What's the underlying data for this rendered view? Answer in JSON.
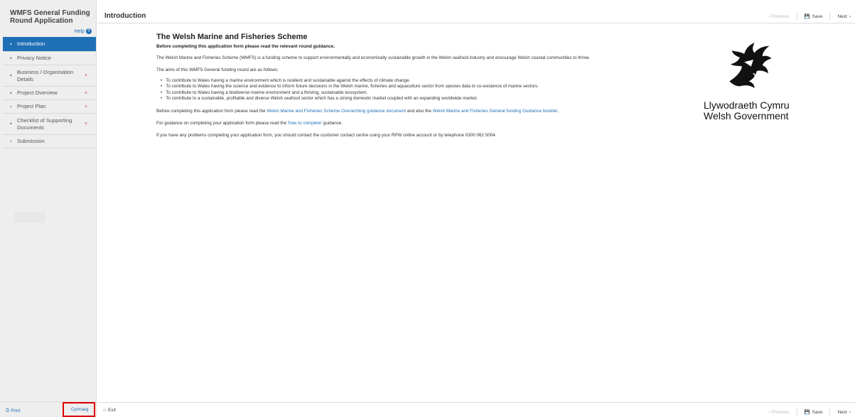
{
  "app": {
    "title": "WMFS General Funding Round Application"
  },
  "sidebar": {
    "help_label": "Help",
    "items": [
      {
        "label": "Introduction",
        "icon": "file-icon",
        "active": true,
        "error": false
      },
      {
        "label": "Privacy Notice",
        "icon": "file-icon",
        "active": false,
        "error": false
      },
      {
        "label": "Business / Organisation Details",
        "icon": "file-icon",
        "active": false,
        "error": true
      },
      {
        "label": "Project Overview",
        "icon": "file-icon",
        "active": false,
        "error": true
      },
      {
        "label": "Project Plan",
        "icon": "chevron-right-icon",
        "active": false,
        "error": true
      },
      {
        "label": "Checklist of Supporting Documents",
        "icon": "file-icon",
        "active": false,
        "error": true
      },
      {
        "label": "Submission",
        "icon": "chevron-right-icon",
        "active": false,
        "error": false
      }
    ],
    "error_mark": "×",
    "print_label": "Print",
    "cymraeg_label": "Cymraeg"
  },
  "header": {
    "page_title": "Introduction",
    "prev_label": "Previous",
    "save_label": "Save",
    "next_label": "Next"
  },
  "content": {
    "heading": "The Welsh Marine and Fisheries Scheme",
    "lead": "Before completing this application form please read the relevant round guidance.",
    "intro": "The Welsh Marine and Fisheries Scheme (WMFS) is a funding scheme to support environmentally and economically sustainable growth in the Welsh seafood industry and encourage Welsh coastal communities to thrive.",
    "aims_intro": "The aims of this WMFS General funding round are as follows:",
    "aims": [
      "To contribute to Wales having a marine environment which is resilient and sustainable against the effects of climate change.",
      "To contribute to Wales having the science and evidence to inform future decisions in the Welsh marine, fisheries and aquaculture sector from species data to co-existence of marine sectors.",
      "To contribute to Wales having a biodiverse marine environment and a thriving, sustainable ecosystem.",
      "To contribute to a sustainable, profitable and diverse Welsh seafood sector which has a strong domestic market coupled with an expanding worldwide market."
    ],
    "guidance_pre": "Before completing this application form please read the ",
    "guidance_link1": "Welsh Marine and Fisheries Scheme Overarching guidance document",
    "guidance_mid": " and also the ",
    "guidance_link2": "Welsh Marine and Fisheries General funding Guidance booklet",
    "guidance_post": ".",
    "howto_pre": "For guidance on completing your application form please read the ",
    "howto_link": "'how to complete'",
    "howto_post": " guidance.",
    "contact": "If you have any problems completing your application form, you should contact the customer contact centre using your RPW online account or by telephone 0300 062 5004."
  },
  "logo": {
    "line1": "Llywodraeth Cymru",
    "line2": "Welsh Government"
  },
  "footer": {
    "exit_label": "Exit",
    "prev_label": "Previous",
    "save_label": "Save",
    "next_label": "Next"
  },
  "colors": {
    "accent": "#1f6fb6",
    "error": "#d9534f",
    "highlight": "#e00000"
  }
}
